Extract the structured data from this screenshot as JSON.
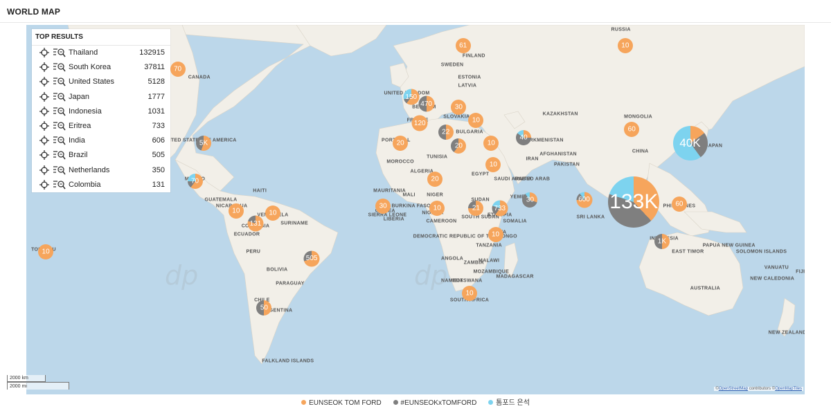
{
  "header": {
    "title": "WORLD MAP"
  },
  "colors": {
    "series1": "#f6a55c",
    "series2": "#7f7f7f",
    "series3": "#7dd3ef",
    "ocean": "#bcd7ea",
    "land": "#f2efe8"
  },
  "top_results": {
    "title": "TOP RESULTS",
    "icons": [
      "crosshair-icon",
      "search-list-icon"
    ],
    "rows": [
      {
        "country": "Thailand",
        "count": "132915"
      },
      {
        "country": "South Korea",
        "count": "37811"
      },
      {
        "country": "United States",
        "count": "5128"
      },
      {
        "country": "Japan",
        "count": "1777"
      },
      {
        "country": "Indonesia",
        "count": "1031"
      },
      {
        "country": "Eritrea",
        "count": "733"
      },
      {
        "country": "India",
        "count": "606"
      },
      {
        "country": "Brazil",
        "count": "505"
      },
      {
        "country": "Netherlands",
        "count": "350"
      },
      {
        "country": "Colombia",
        "count": "131"
      }
    ]
  },
  "map_labels": [
    "CANADA",
    "RUSSIA",
    "FINLAND",
    "SWEDEN",
    "ESTONIA",
    "LATVIA",
    "UNITED KINGDOM",
    "BELGIUM",
    "SLOVAKIA",
    "FRANCE",
    "BULGARIA",
    "PORTUGAL",
    "TUNISIA",
    "MOROCCO",
    "ALGERIA",
    "EGYPT",
    "MAURITANIA",
    "MALI",
    "NIGER",
    "SUDAN",
    "NIGERIA",
    "GUINEA",
    "BURKINA FASO",
    "SIERRA LEONE",
    "LIBERIA",
    "CAMEROON",
    "SOUTH SUDAN",
    "ETHIOPIA",
    "DEMOCRATIC REPUBLIC OF THE CONGO",
    "ANGOLA",
    "TANZANIA",
    "ZAMBIA",
    "NAMIBIA",
    "BOTSWANA",
    "SOUTH AFRICA",
    "MADAGASCAR",
    "SAUDI ARABIA",
    "YEMEN",
    "IRAN",
    "TURKMENISTAN",
    "KAZAKHSTAN",
    "MONGOLIA",
    "AFGHANISTAN",
    "PAKISTAN",
    "CHINA",
    "UNITED ARAB",
    "SRI LANKA",
    "JAPAN",
    "PHILIPPINES",
    "INDONESIA",
    "EAST TIMOR",
    "PAPUA NEW GUINEA",
    "SOLOMON ISLANDS",
    "VANUATU",
    "AUSTRALIA",
    "NEW ZEALAND",
    "UNITED STATES OF AMERICA",
    "MEXICO",
    "GUATEMALA",
    "NICARAGUA",
    "HAITI",
    "VENEZUELA",
    "SURINAME",
    "COLOMBIA",
    "ECUADOR",
    "PERU",
    "BOLIVIA",
    "PARAGUAY",
    "CHILE",
    "ARGENTINA",
    "FALKLAND ISLANDS",
    "TOKELAU",
    "NEW CALEDONIA",
    "FIJI",
    "KENYA",
    "SOMALIA",
    "MALAWI",
    "MOZAMBIQUE"
  ],
  "clusters": [
    {
      "label": "70",
      "lon": -110,
      "lat": 60,
      "shares": [
        1,
        0,
        0
      ]
    },
    {
      "label": "5K",
      "lon": -98,
      "lat": 38,
      "shares": [
        0.55,
        0.45,
        0
      ]
    },
    {
      "label": "70",
      "lon": -102,
      "lat": 23,
      "shares": [
        0.6,
        0.15,
        0.25
      ]
    },
    {
      "label": "10",
      "lon": -83,
      "lat": 10,
      "shares": [
        1,
        0,
        0
      ]
    },
    {
      "label": "10",
      "lon": -66,
      "lat": 9,
      "shares": [
        1,
        0,
        0
      ]
    },
    {
      "label": "131",
      "lon": -74,
      "lat": 4,
      "shares": [
        0.8,
        0.2,
        0
      ]
    },
    {
      "label": "505",
      "lon": -48,
      "lat": -12,
      "shares": [
        0.7,
        0.3,
        0
      ]
    },
    {
      "label": "50",
      "lon": -70,
      "lat": -33,
      "shares": [
        0.5,
        0.5,
        0
      ]
    },
    {
      "label": "10",
      "lon": -171,
      "lat": -9,
      "shares": [
        1,
        0,
        0
      ]
    },
    {
      "label": "61",
      "lon": 22,
      "lat": 65,
      "shares": [
        1,
        0,
        0
      ]
    },
    {
      "label": "150",
      "lon": -2,
      "lat": 53,
      "shares": [
        0.6,
        0.1,
        0.3
      ]
    },
    {
      "label": "470",
      "lon": 5,
      "lat": 51,
      "shares": [
        0.5,
        0.5,
        0
      ]
    },
    {
      "label": "30",
      "lon": 20,
      "lat": 50,
      "shares": [
        1,
        0,
        0
      ]
    },
    {
      "label": "120",
      "lon": 2,
      "lat": 45,
      "shares": [
        1,
        0,
        0
      ]
    },
    {
      "label": "22",
      "lon": 14,
      "lat": 42,
      "shares": [
        0.5,
        0.5,
        0
      ]
    },
    {
      "label": "10",
      "lon": 28,
      "lat": 46,
      "shares": [
        1,
        0,
        0
      ]
    },
    {
      "label": "20",
      "lon": -7,
      "lat": 38,
      "shares": [
        1,
        0,
        0
      ]
    },
    {
      "label": "20",
      "lon": 20,
      "lat": 37,
      "shares": [
        0.6,
        0.4,
        0
      ]
    },
    {
      "label": "10",
      "lon": 35,
      "lat": 38,
      "shares": [
        1,
        0,
        0
      ]
    },
    {
      "label": "40",
      "lon": 50,
      "lat": 40,
      "shares": [
        0.25,
        0.6,
        0.15
      ]
    },
    {
      "label": "10",
      "lon": 36,
      "lat": 30,
      "shares": [
        1,
        0,
        0
      ]
    },
    {
      "label": "20",
      "lon": 9,
      "lat": 24,
      "shares": [
        1,
        0,
        0
      ]
    },
    {
      "label": "30",
      "lon": -15,
      "lat": 12,
      "shares": [
        1,
        0,
        0
      ]
    },
    {
      "label": "10",
      "lon": 10,
      "lat": 11,
      "shares": [
        1,
        0,
        0
      ]
    },
    {
      "label": "21",
      "lon": 28,
      "lat": 11,
      "shares": [
        0.75,
        0.25,
        0
      ]
    },
    {
      "label": "733",
      "lon": 39,
      "lat": 11,
      "shares": [
        0.6,
        0.2,
        0.2
      ]
    },
    {
      "label": "30",
      "lon": 53,
      "lat": 15,
      "shares": [
        0.3,
        0.6,
        0.1
      ]
    },
    {
      "label": "10",
      "lon": 37,
      "lat": -1,
      "shares": [
        1,
        0,
        0
      ]
    },
    {
      "label": "10",
      "lon": 25,
      "lat": -27,
      "shares": [
        1,
        0,
        0
      ]
    },
    {
      "label": "600",
      "lon": 78,
      "lat": 15,
      "shares": [
        0.75,
        0.15,
        0.1
      ]
    },
    {
      "label": "60",
      "lon": 100,
      "lat": 43,
      "shares": [
        1,
        0,
        0
      ]
    },
    {
      "label": "10",
      "lon": 97,
      "lat": 65,
      "shares": [
        1,
        0,
        0
      ]
    },
    {
      "label": "133K",
      "lon": 101,
      "lat": 14,
      "shares": [
        0.38,
        0.42,
        0.2
      ]
    },
    {
      "label": "40K",
      "lon": 127,
      "lat": 38,
      "shares": [
        0.15,
        0.25,
        0.6
      ]
    },
    {
      "label": "60",
      "lon": 122,
      "lat": 13,
      "shares": [
        1,
        0,
        0
      ]
    },
    {
      "label": "1K",
      "lon": 114,
      "lat": -4,
      "shares": [
        0.5,
        0.5,
        0
      ]
    }
  ],
  "scale": {
    "km": "2000 km",
    "mi": "2000 mi"
  },
  "attribution": {
    "prefix": "©",
    "osm": "OpenStreetMap",
    "mid": " contributors ©",
    "omt": "OpenMapTiles"
  },
  "watermark": "dp",
  "legend": [
    {
      "label": "EUNSEOK TOM FORD",
      "color": "#f6a55c"
    },
    {
      "label": "#EUNSEOKxTOMFORD",
      "color": "#7f7f7f"
    },
    {
      "label": "톰포드 은석",
      "color": "#7dd3ef"
    }
  ]
}
